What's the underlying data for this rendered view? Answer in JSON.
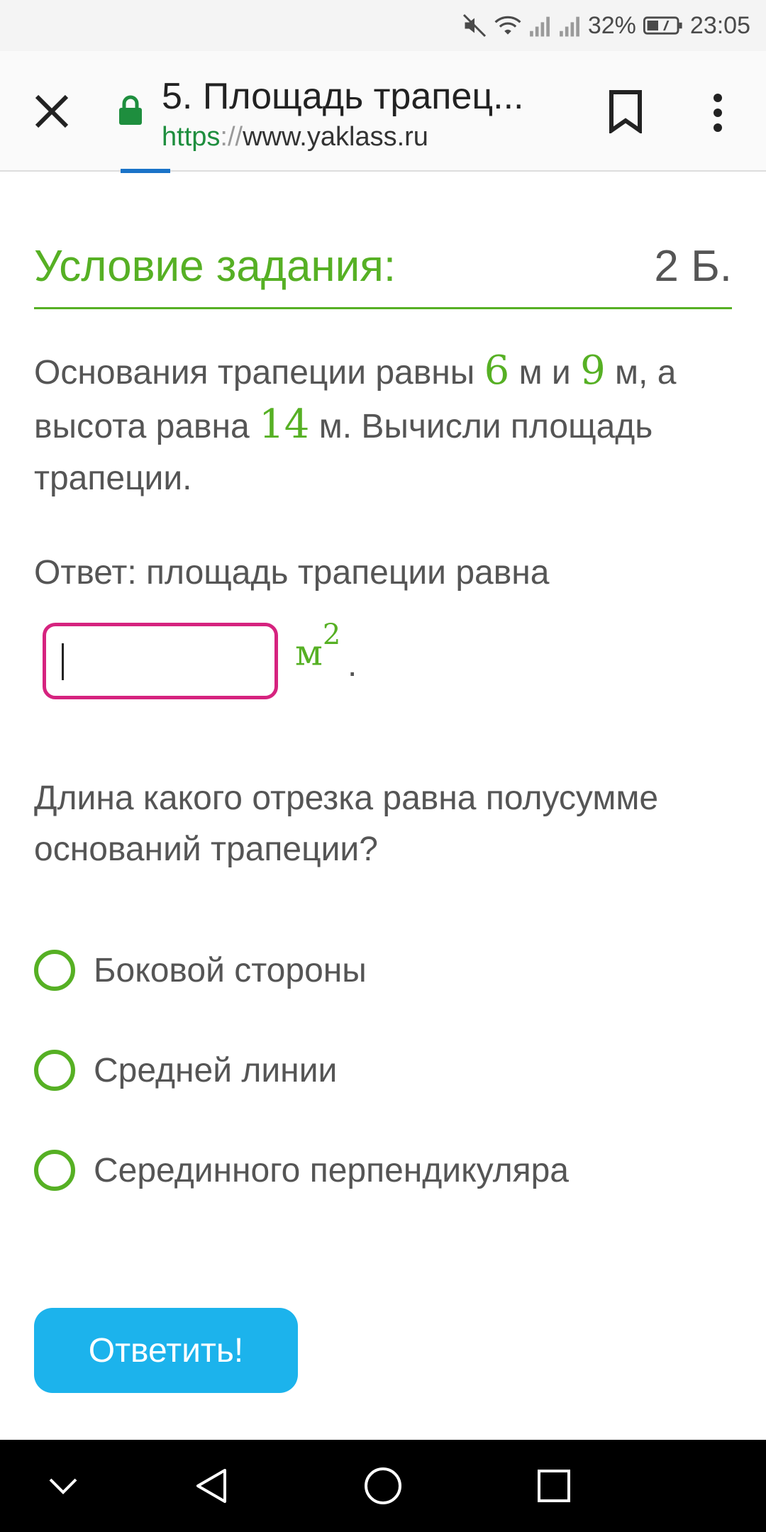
{
  "status_bar": {
    "battery": "32%",
    "time": "23:05",
    "icons": [
      "mute-icon",
      "wifi-icon",
      "signal-icon",
      "signal-icon",
      "battery-icon"
    ]
  },
  "browser": {
    "title": "5. Площадь трапец...",
    "url_scheme": "https",
    "url_sep": "://",
    "url_host": "www.yaklass.ru",
    "icons": [
      "close-icon",
      "lock-icon",
      "bookmark-icon",
      "more-vert-icon"
    ]
  },
  "task": {
    "header_title": "Условие задания:",
    "points": "2 Б.",
    "q_part1": "Основания трапеции равны ",
    "num_a": "6",
    "q_part2": " м и ",
    "num_b": "9",
    "q_part3": " м, а высота равна ",
    "num_h": "14",
    "q_part4": " м. Вычисли площадь трапеции.",
    "answer_label": "Ответ: площадь трапеции равна",
    "answer_value": "",
    "unit": "м",
    "unit_power": "2",
    "unit_dot": ".",
    "question2": "Длина какого отрезка равна полусумме оснований трапеции?",
    "options": [
      {
        "label": "Боковой стороны"
      },
      {
        "label": "Средней линии"
      },
      {
        "label": "Серединного перпендикуляра"
      }
    ],
    "submit_label": "Ответить!"
  },
  "colors": {
    "accent_green": "#56b024",
    "input_border": "#d6237f",
    "button_blue": "#1cb3ec",
    "text": "#555555"
  },
  "nav": {
    "icons": [
      "chevron-down-icon",
      "back-icon",
      "home-icon",
      "recents-icon"
    ]
  }
}
